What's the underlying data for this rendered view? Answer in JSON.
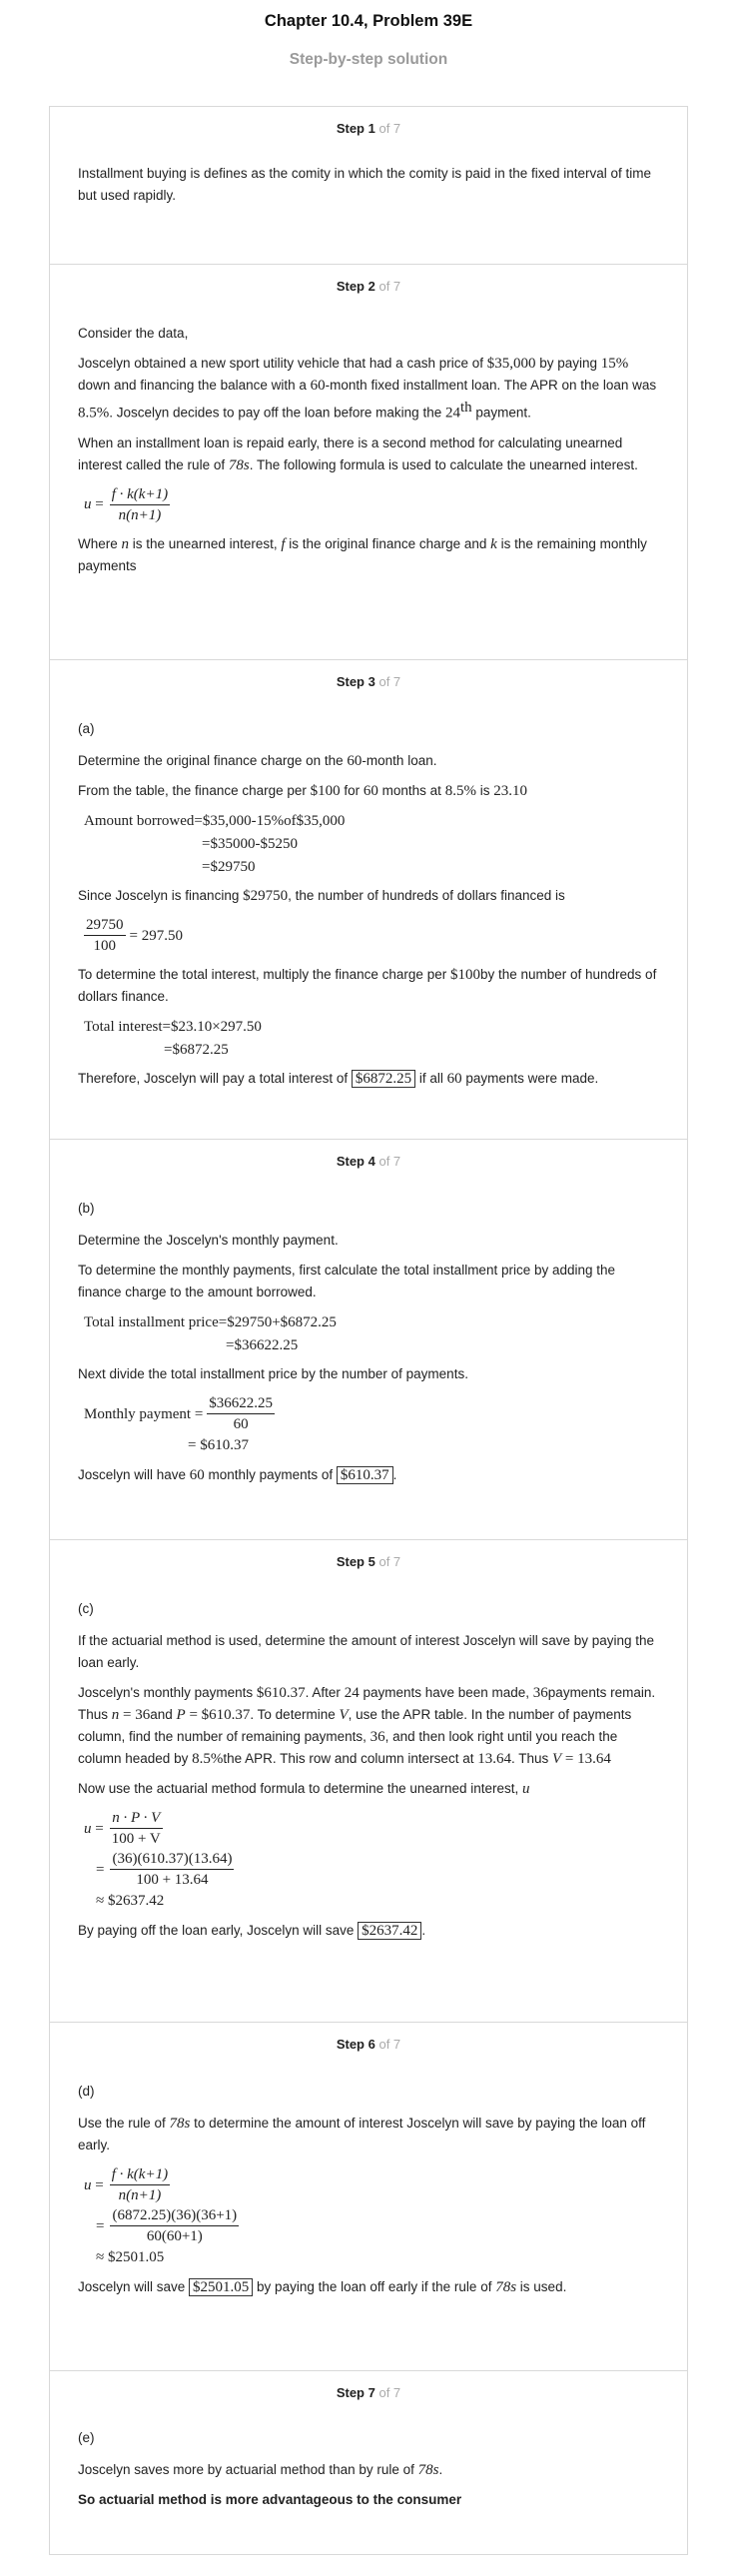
{
  "header": {
    "title": "Chapter 10.4, Problem 39E",
    "subtitle": "Step-by-step solution"
  },
  "steps": [
    {
      "label": "Step 1",
      "of": "of 7",
      "text": "Installment buying is defines as the comity in which the comity is paid in the fixed interval of time but used rapidly."
    },
    {
      "label": "Step 2",
      "of": "of 7",
      "consider": "Consider the data,",
      "p1": {
        "a": "Joscelyn obtained a new sport utility vehicle that had a cash price of ",
        "price": "$35,000",
        "b": " by paying ",
        "pct": "15%",
        "c": " down and financing the balance with a ",
        "months": "60",
        "d": "-month fixed installment loan. The APR on the loan was ",
        "apr": "8.5%",
        "e": ". Joscelyn decides to pay off the loan before making the ",
        "nth": "24",
        "nth_sup": "th",
        "f": " payment."
      },
      "p2": {
        "a": "When an installment loan is repaid early, there is a second method for calculating unearned interest called the rule of ",
        "rule": "78s",
        "b": ". The following formula is used to calculate the unearned interest."
      },
      "formula": {
        "lhs": "u",
        "num": "f · k(k+1)",
        "den": "n(n+1)"
      },
      "p3": {
        "a": "Where ",
        "n": "n",
        "b": " is the unearned interest, ",
        "f": "f",
        "c": " is the original finance charge and ",
        "k": "k",
        "d": " is the remaining monthly payments"
      }
    },
    {
      "label": "Step 3",
      "of": "of 7",
      "part": "(a)",
      "p1": {
        "a": "Determine the original finance charge on the ",
        "m": "60",
        "b": "-month loan."
      },
      "p2": {
        "a": "From the table, the finance charge per ",
        "per": "$100",
        "b": " for ",
        "m": "60",
        "c": " months at ",
        "apr": "8.5%",
        "d": " is ",
        "val": "23.10"
      },
      "calc1": [
        "Amount borrowed=$35,000-15%of$35,000",
        "=$35000-$5250",
        "=$29750"
      ],
      "p3": {
        "a": "Since Joscelyn is financing ",
        "amt": "$29750",
        "b": ", the number of hundreds of dollars financed is"
      },
      "frac": {
        "num": "29750",
        "den": "100",
        "rhs": "= 297.50"
      },
      "p4": {
        "a": "To determine the total interest, multiply the finance charge per ",
        "per": "$100",
        "b": "by the number of hundreds of dollars finance."
      },
      "calc2": [
        "Total interest=$23.10×297.50",
        "=$6872.25"
      ],
      "p5": {
        "a": "Therefore, Joscelyn will pay a total interest of ",
        "ans": "$6872.25",
        "b": " if all ",
        "m": "60",
        "c": " payments were made."
      }
    },
    {
      "label": "Step 4",
      "of": "of 7",
      "part": "(b)",
      "p1": "Determine the Joscelyn's monthly payment.",
      "p2": "To determine the monthly payments, first calculate the total installment price by adding the finance charge to the amount borrowed.",
      "calc1": [
        "Total installment price=$29750+$6872.25",
        "=$36622.25"
      ],
      "p3": "Next divide the total installment price by the number of payments.",
      "monthly": {
        "lhs": "Monthly payment =",
        "num": "$36622.25",
        "den": "60",
        "rhs": "= $610.37"
      },
      "p4": {
        "a": "Joscelyn will have ",
        "m": "60",
        "b": " monthly payments of ",
        "ans": "$610.37",
        "c": "."
      }
    },
    {
      "label": "Step 5",
      "of": "of 7",
      "part": "(c)",
      "p1": "If the actuarial method is used, determine the amount of interest Joscelyn will save by paying the loan early.",
      "p2": {
        "a": "Joscelyn's monthly payments ",
        "pay": "$610.37",
        "b": ". After ",
        "after": "24",
        "c": " payments have been made, ",
        "rem": "36",
        "d": "payments remain. Thus ",
        "n": "n",
        "neq": " = 36",
        "e": "and ",
        "P": "P",
        "peq": " = $610.37",
        "f": ". To determine ",
        "V": "V",
        "g": ", use the APR table. In the number of payments column, find the number of remaining payments, ",
        "rem2": "36",
        "h": ", and then look right until you reach the column headed by ",
        "apr": "8.5%",
        "i": "the APR. This row and column intersect at ",
        "val": "13.64",
        "j": ". Thus ",
        "V2": "V",
        "veq": " = 13.64"
      },
      "p3": {
        "a": "Now use the actuarial method formula to determine the unearned interest, ",
        "u": "u"
      },
      "formula": {
        "lhs": "u",
        "num1": "n · P · V",
        "den1": "100 + V",
        "num2": "(36)(610.37)(13.64)",
        "den2": "100 + 13.64",
        "approx": "≈ $2637.42"
      },
      "p4": {
        "a": "By paying off the loan early, Joscelyn will save ",
        "ans": "$2637.42",
        "b": "."
      }
    },
    {
      "label": "Step 6",
      "of": "of 7",
      "part": "(d)",
      "p1": {
        "a": "Use the rule of ",
        "rule": "78s",
        "b": " to determine the amount of interest Joscelyn will save by paying the loan off early."
      },
      "formula": {
        "lhs": "u",
        "num1": "f · k(k+1)",
        "den1": "n(n+1)",
        "num2": "(6872.25)(36)(36+1)",
        "den2": "60(60+1)",
        "approx": "≈ $2501.05"
      },
      "p2": {
        "a": "Joscelyn will save ",
        "ans": "$2501.05",
        "b": " by paying the loan off early if the rule of ",
        "rule": "78s",
        "c": " is used."
      }
    },
    {
      "label": "Step 7",
      "of": "of 7",
      "part": "(e)",
      "p1": {
        "a": "Joscelyn saves more by actuarial method than by rule of ",
        "rule": "78s",
        "b": "."
      },
      "p2": "So actuarial method is more advantageous to the consumer"
    }
  ]
}
